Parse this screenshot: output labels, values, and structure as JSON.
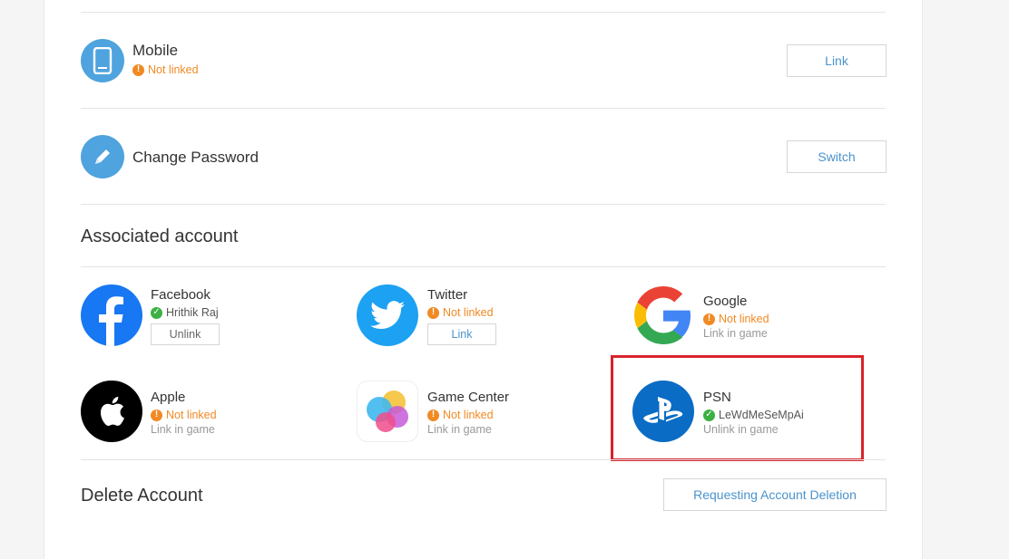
{
  "mobile": {
    "title": "Mobile",
    "status": "Not linked",
    "button": "Link"
  },
  "password": {
    "title": "Change Password",
    "button": "Switch"
  },
  "associated": {
    "title": "Associated account",
    "accounts": [
      {
        "name": "Facebook",
        "status": "Hrithik Raj",
        "linked": true,
        "action": "Unlink"
      },
      {
        "name": "Twitter",
        "status": "Not linked",
        "linked": false,
        "action": "Link"
      },
      {
        "name": "Google",
        "status": "Not linked",
        "linked": false,
        "note": "Link in game"
      },
      {
        "name": "Apple",
        "status": "Not linked",
        "linked": false,
        "note": "Link in game"
      },
      {
        "name": "Game Center",
        "status": "Not linked",
        "linked": false,
        "note": "Link in game"
      },
      {
        "name": "PSN",
        "status": "LeWdMeSeMpAi",
        "linked": true,
        "note": "Unlink in game"
      }
    ]
  },
  "delete": {
    "title": "Delete Account",
    "button": "Requesting Account Deletion"
  },
  "colors": {
    "accent": "#4a93cc",
    "warning": "#f08a24",
    "success": "#3cb043",
    "highlight": "#d9232b"
  }
}
